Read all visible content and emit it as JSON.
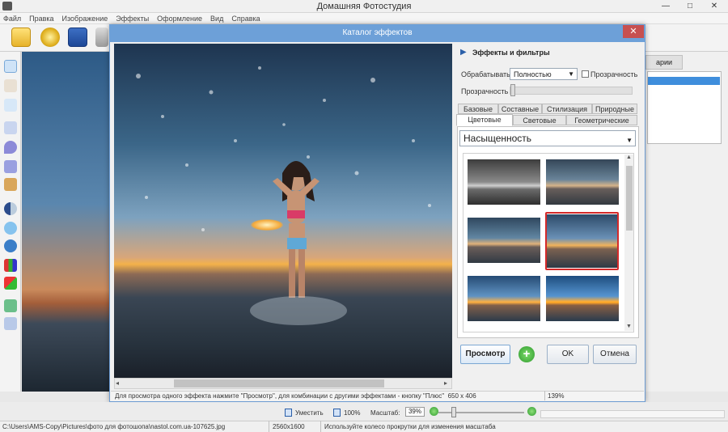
{
  "app": {
    "title": "Домашняя Фотостудия",
    "window_buttons": [
      "—",
      "□",
      "✕"
    ]
  },
  "menu": [
    "Файл",
    "Правка",
    "Изображение",
    "Эффекты",
    "Оформление",
    "Вид",
    "Справка"
  ],
  "toolbar": {
    "icons": [
      "open-folder-icon",
      "film-reel-icon",
      "save-disk-icon",
      "print-icon"
    ]
  },
  "left_tools": [
    "pointer-icon",
    "hand-icon",
    "zoom-icon",
    "brush-icon",
    "drop-icon",
    "cone-icon",
    "stamp-icon",
    "contrast-icon",
    "eye-icon",
    "eye-red-icon",
    "palette-icon",
    "fill-icon",
    "eraser-icon",
    "crop-icon"
  ],
  "right_panel": {
    "tab_label": "арии"
  },
  "dialog": {
    "title": "Каталог эффектов",
    "close": "✕",
    "panel_title": "Эффекты и фильтры",
    "process_label": "Обрабатывать",
    "process_value": "Полностью",
    "transparency_check": "Прозрачность",
    "transparency_label": "Прозрачность",
    "tabs_row1": [
      "Базовые",
      "Составные",
      "Стилизация",
      "Природные"
    ],
    "tabs_row2": [
      "Цветовые",
      "Световые",
      "Геометрические"
    ],
    "active_tab": "Цветовые",
    "effect_select": "Насыщенность",
    "thumbnails": 6,
    "selected_thumbnail": 4,
    "buttons": {
      "preview": "Просмотр",
      "plus": "+",
      "ok": "OK",
      "cancel": "Отмена"
    },
    "status_hint": "Для просмотра одного эффекта нажмите \"Просмотр\", для комбинации с другими эффектами - кнопку \"Плюс\"",
    "image_size": "650 x 406",
    "zoom": "139%"
  },
  "zoom_bar": {
    "fit_label": "Уместить",
    "actual_label": "100%",
    "scale_label": "Масштаб:",
    "scale_value": "39%"
  },
  "status_bar": {
    "path": "C:\\Users\\AMS-Copy\\Pictures\\фото для фотошопа\\nastol.com.ua-107625.jpg",
    "dimensions": "2560x1600",
    "hint": "Используйте колесо прокрутки для изменения масштаба"
  }
}
